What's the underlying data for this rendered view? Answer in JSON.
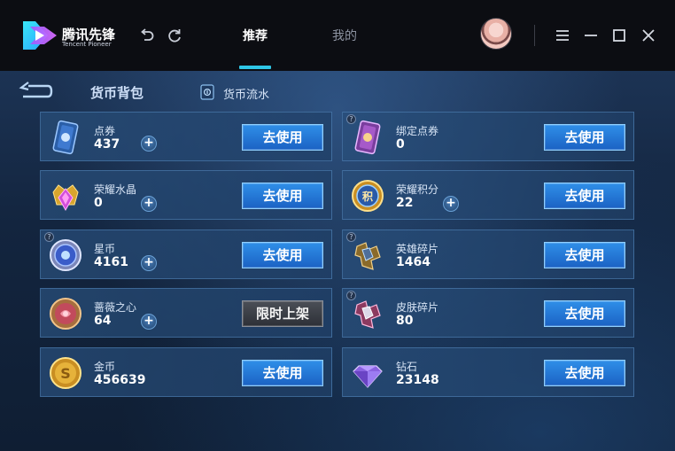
{
  "app": {
    "brand_cn": "腾讯先锋",
    "brand_en": "Tencent Pioneer"
  },
  "nav": {
    "tabs": [
      {
        "label": "推荐",
        "active": true
      },
      {
        "label": "我的",
        "active": false
      }
    ]
  },
  "header": {
    "title": "货币背包",
    "flow_link": "货币流水"
  },
  "currencies": [
    {
      "name": "点券",
      "amount": "437",
      "has_help": false,
      "has_plus": true,
      "button": "去使用",
      "button_style": "blue",
      "icon": "voucher-card-icon"
    },
    {
      "name": "绑定点券",
      "amount": "0",
      "has_help": true,
      "has_plus": false,
      "button": "去使用",
      "button_style": "blue",
      "icon": "bound-voucher-icon"
    },
    {
      "name": "荣耀水晶",
      "amount": "0",
      "has_help": false,
      "has_plus": true,
      "button": "去使用",
      "button_style": "blue",
      "icon": "glory-crystal-icon"
    },
    {
      "name": "荣耀积分",
      "amount": "22",
      "has_help": false,
      "has_plus": true,
      "button": "去使用",
      "button_style": "blue",
      "icon": "glory-points-icon"
    },
    {
      "name": "星币",
      "amount": "4161",
      "has_help": true,
      "has_plus": true,
      "button": "去使用",
      "button_style": "blue",
      "icon": "star-coin-icon"
    },
    {
      "name": "英雄碎片",
      "amount": "1464",
      "has_help": true,
      "has_plus": false,
      "button": "去使用",
      "button_style": "blue",
      "icon": "hero-shard-icon"
    },
    {
      "name": "蔷薇之心",
      "amount": "64",
      "has_help": false,
      "has_plus": true,
      "button": "限时上架",
      "button_style": "gray",
      "icon": "rose-heart-icon"
    },
    {
      "name": "皮肤碎片",
      "amount": "80",
      "has_help": true,
      "has_plus": false,
      "button": "去使用",
      "button_style": "blue",
      "icon": "skin-shard-icon"
    },
    {
      "name": "金币",
      "amount": "456639",
      "has_help": false,
      "has_plus": false,
      "button": "去使用",
      "button_style": "blue",
      "icon": "gold-coin-icon"
    },
    {
      "name": "钻石",
      "amount": "23148",
      "has_help": false,
      "has_plus": false,
      "button": "去使用",
      "button_style": "blue",
      "icon": "diamond-icon"
    }
  ],
  "colors": {
    "accent": "#2fc6e6",
    "button_blue": "#1f6fd0",
    "titlebar_bg": "#0c0d12",
    "panel_bg": "#15294a"
  }
}
